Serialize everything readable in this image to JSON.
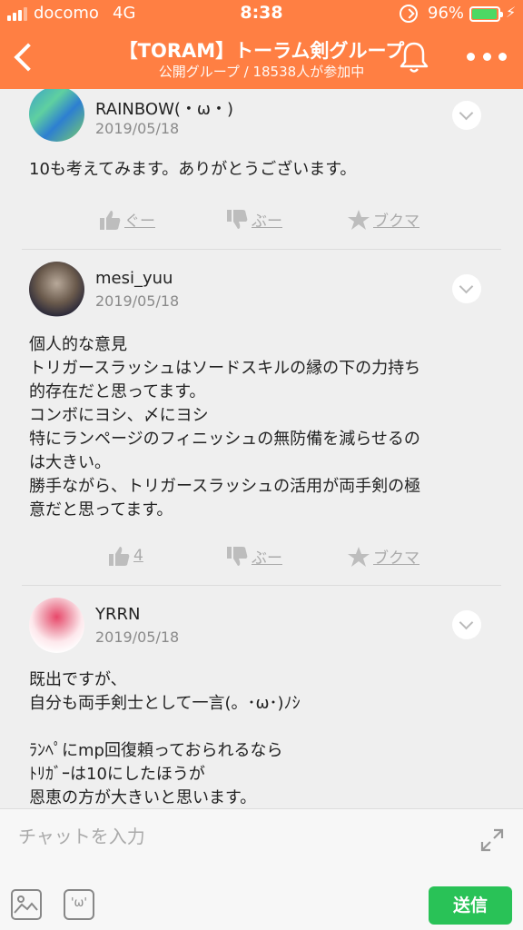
{
  "status_bar": {
    "carrier": "docomo",
    "network": "4G",
    "time": "8:38",
    "battery_percent": "96%",
    "battery_level": 0.96
  },
  "header": {
    "title": "【TORAM】トーラム剣グループ",
    "subtitle": "公開グループ / 18538人が参加中",
    "accent_color": "#ff7f43"
  },
  "posts": [
    {
      "username": "RAINBOW(・ω・)",
      "date": "2019/05/18",
      "body": "10も考えてみます。ありがとうございます。",
      "like_label": "ぐー",
      "dislike_label": "ぶー",
      "bookmark_label": "ブクマ"
    },
    {
      "username": "mesi_yuu",
      "date": "2019/05/18",
      "body": "個人的な意見\nトリガースラッシュはソードスキルの縁の下の力持ち\n的存在だと思ってます。\nコンボにヨシ、〆にヨシ\n特にランページのフィニッシュの無防備を減らせるの\nは大きい。\n勝手ながら、トリガースラッシュの活用が両手剣の極\n意だと思ってます。",
      "like_label": "4",
      "dislike_label": "ぶー",
      "bookmark_label": "ブクマ"
    },
    {
      "username": "YRRN",
      "date": "2019/05/18",
      "body": "既出ですが、\n自分も両手剣士として一言(。･ω･)ﾉｼ\n\nﾗﾝﾍﾟにmp回復頼っておられるなら\nﾄﾘｶﾞｰは10にしたほうが\n恩恵の方が大きいと思います。"
    }
  ],
  "input_bar": {
    "placeholder": "チャットを入力",
    "send_label": "送信",
    "emoji_glyph": "'ω'",
    "send_color": "#29c257"
  }
}
